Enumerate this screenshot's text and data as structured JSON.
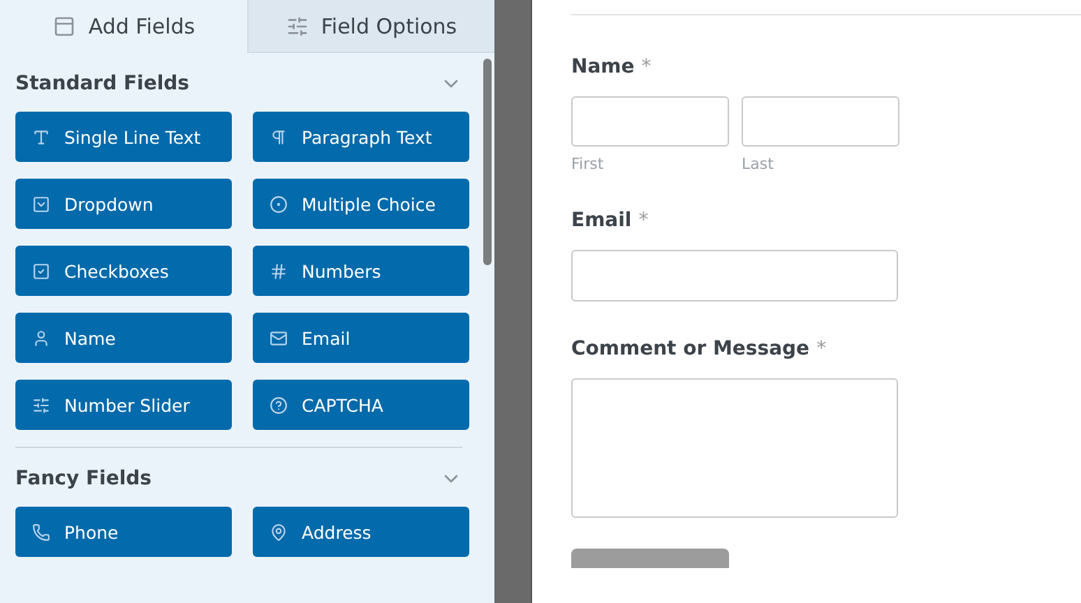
{
  "tabs": [
    {
      "label": "Add Fields",
      "selected": true
    },
    {
      "label": "Field Options",
      "selected": false
    }
  ],
  "sections": [
    {
      "title": "Standard Fields",
      "expanded": true,
      "fields": [
        {
          "label": "Single Line Text",
          "kind": "text"
        },
        {
          "label": "Paragraph Text",
          "kind": "paragraph"
        },
        {
          "label": "Dropdown",
          "kind": "dropdown"
        },
        {
          "label": "Multiple Choice",
          "kind": "radio"
        },
        {
          "label": "Checkboxes",
          "kind": "checkbox"
        },
        {
          "label": "Numbers",
          "kind": "number"
        },
        {
          "label": "Name",
          "kind": "name"
        },
        {
          "label": "Email",
          "kind": "email"
        },
        {
          "label": "Number Slider",
          "kind": "slider"
        },
        {
          "label": "CAPTCHA",
          "kind": "captcha"
        }
      ]
    },
    {
      "title": "Fancy Fields",
      "expanded": true,
      "fields": [
        {
          "label": "Phone",
          "kind": "phone"
        },
        {
          "label": "Address",
          "kind": "address"
        }
      ]
    }
  ],
  "form": {
    "fields": [
      {
        "kind": "name",
        "label": "Name",
        "required_mark": "*",
        "sublabels": [
          "First",
          "Last"
        ]
      },
      {
        "kind": "email",
        "label": "Email",
        "required_mark": "*"
      },
      {
        "kind": "textarea",
        "label": "Comment or Message",
        "required_mark": "*"
      }
    ]
  }
}
